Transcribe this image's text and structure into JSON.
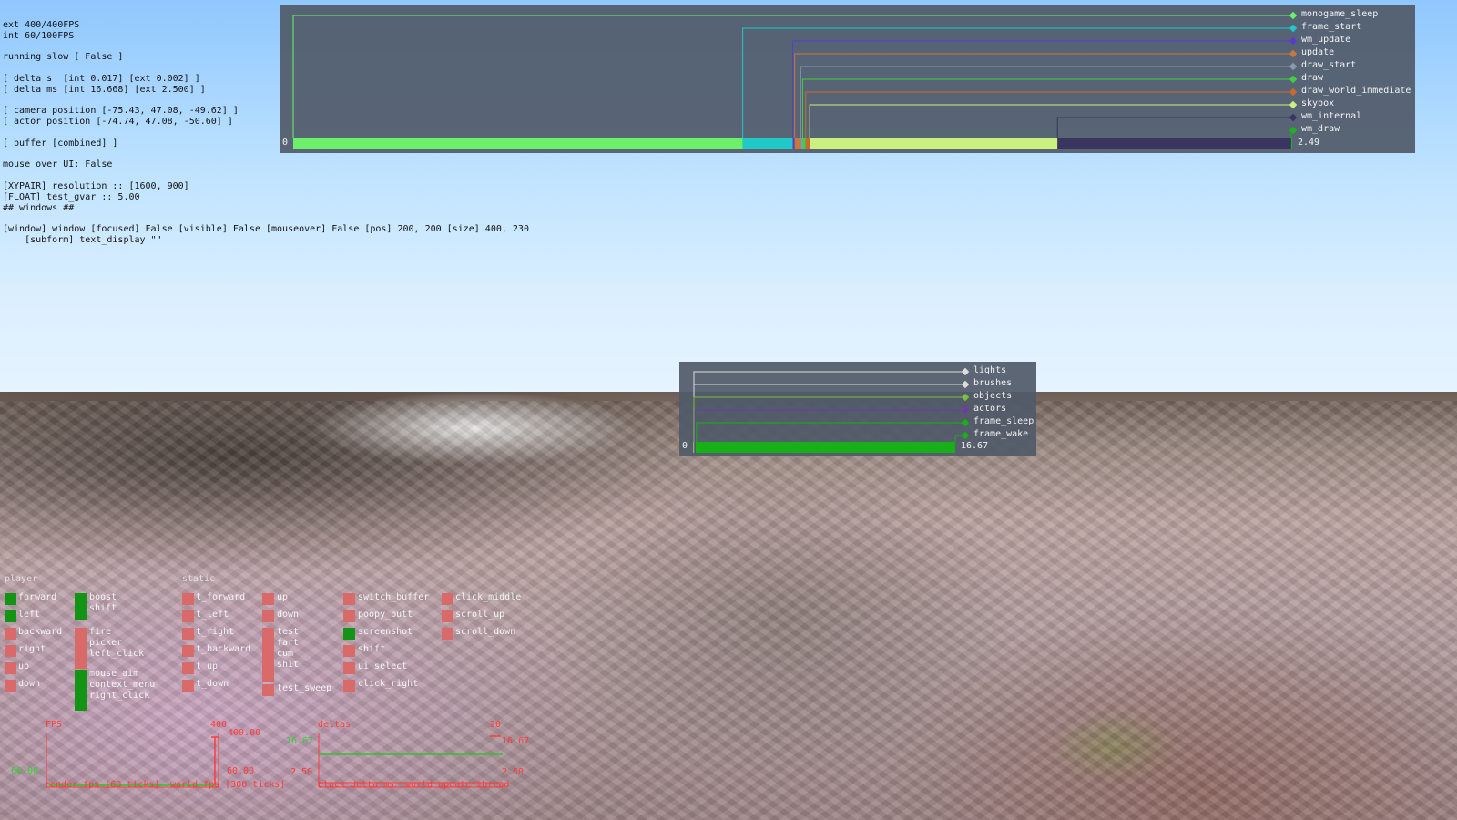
{
  "debug_overlay": {
    "lines": [
      "ext 400/400FPS",
      "int 60/100FPS",
      "",
      "running slow [ False ]",
      "",
      "[ delta s  [int 0.017] [ext 0.002] ]",
      "[ delta ms [int 16.668] [ext 2.500] ]",
      "",
      "[ camera position [-75.43, 47.08, -49.62] ]",
      "[ actor position [-74.74, 47.08, -50.60] ]",
      "",
      "[ buffer [combined] ]",
      "",
      "mouse over UI: False",
      "",
      "[XYPAIR] resolution :: [1600, 900]",
      "[FLOAT] test_gvar :: 5.00",
      "## windows ##",
      "",
      "[window] window [focused] False [visible] False [mouseover] False [pos] 200, 200 [size] 400, 230",
      "    [subform] text_display \"\""
    ]
  },
  "frame_profiler": {
    "zero": "0",
    "value": "2.49",
    "labels": [
      "monogame_sleep",
      "frame_start",
      "wm_update",
      "update",
      "draw_start",
      "draw",
      "draw_world_immediate",
      "skybox",
      "wm_internal",
      "wm_draw"
    ],
    "colors": [
      "#6cf06c",
      "#20c8c8",
      "#5a3cc8",
      "#c8783a",
      "#8a9aaa",
      "#40d040",
      "#c86a30",
      "#ccf080",
      "#3a3460",
      "#20b020"
    ],
    "segments": [
      {
        "label": "monogame_sleep",
        "start": 0.0,
        "end": 0.45
      },
      {
        "label": "frame_start",
        "start": 0.45,
        "end": 0.5
      },
      {
        "label": "wm_update",
        "start": 0.5,
        "end": 0.502
      },
      {
        "label": "update",
        "start": 0.502,
        "end": 0.508
      },
      {
        "label": "draw_start",
        "start": 0.508,
        "end": 0.51
      },
      {
        "label": "draw",
        "start": 0.51,
        "end": 0.513
      },
      {
        "label": "draw_world_immediate",
        "start": 0.513,
        "end": 0.517
      },
      {
        "label": "skybox",
        "start": 0.517,
        "end": 0.765
      },
      {
        "label": "wm_internal",
        "start": 0.765,
        "end": 0.999
      },
      {
        "label": "wm_draw",
        "start": 0.999,
        "end": 1.0
      }
    ]
  },
  "world_profiler": {
    "zero": "0",
    "value": "16.67",
    "labels": [
      "lights",
      "brushes",
      "objects",
      "actors",
      "frame_sleep",
      "frame_wake"
    ],
    "colors": [
      "#dcdcdc",
      "#dcdcdc",
      "#7ac040",
      "#6a3caa",
      "#18b018",
      "#18b018"
    ],
    "segments": [
      {
        "label": "lights",
        "start": 0.0,
        "end": 0.0
      },
      {
        "label": "brushes",
        "start": 0.0,
        "end": 0.0
      },
      {
        "label": "objects",
        "start": 0.0,
        "end": 0.005
      },
      {
        "label": "actors",
        "start": 0.005,
        "end": 0.01
      },
      {
        "label": "frame_sleep",
        "start": 0.01,
        "end": 0.997
      },
      {
        "label": "frame_wake",
        "start": 0.997,
        "end": 1.0
      }
    ]
  },
  "inputs": {
    "player_heading": "player",
    "static_heading": "static",
    "active_color": "#149414",
    "inactive_color": "#d86a6a",
    "player": [
      {
        "label": "forward",
        "active": true
      },
      {
        "label": "left",
        "active": true
      },
      {
        "label": "backward",
        "active": false
      },
      {
        "label": "right",
        "active": false
      },
      {
        "label": "up",
        "active": false
      },
      {
        "label": "down",
        "active": false
      },
      {
        "label": "boost\nshift",
        "active": true
      },
      {
        "label": "fire\npicker\nleft_click",
        "active": false
      },
      {
        "label": "mouse_aim\ncontext_menu\nright_click",
        "active": true
      }
    ],
    "static": [
      {
        "label": "t_forward",
        "active": false
      },
      {
        "label": "t_left",
        "active": false
      },
      {
        "label": "t_right",
        "active": false
      },
      {
        "label": "t_backward",
        "active": false
      },
      {
        "label": "t_up",
        "active": false
      },
      {
        "label": "t_down",
        "active": false
      },
      {
        "label": "up",
        "active": false
      },
      {
        "label": "down",
        "active": false
      },
      {
        "label": "test\nfart\ncum\nshit",
        "active": false
      },
      {
        "label": "test_sweep",
        "active": false
      },
      {
        "label": "switch_buffer",
        "active": false
      },
      {
        "label": "poopy_butt",
        "active": false
      },
      {
        "label": "screenshot",
        "active": true
      },
      {
        "label": "shift",
        "active": false
      },
      {
        "label": "ui_select",
        "active": false
      },
      {
        "label": "click_right",
        "active": false
      },
      {
        "label": "click_middle",
        "active": false
      },
      {
        "label": "scroll_up",
        "active": false
      },
      {
        "label": "scroll_down",
        "active": false
      }
    ]
  },
  "graphs": {
    "fps": {
      "title": "FPS",
      "top_max": "400",
      "top_value": "400.00",
      "left_value": "60.00",
      "right_value": "60.00",
      "caption_left": "render fps [60 ticks]",
      "caption_right": "world fps [300 ticks]"
    },
    "deltas": {
      "title": "deltas",
      "top_max": "20",
      "upper_left": "16.67",
      "upper_right": "16.67",
      "lower_left": "2.50",
      "lower_right": "2.50",
      "caption_left": "clock delta ms",
      "caption_right": "world update thread"
    }
  }
}
